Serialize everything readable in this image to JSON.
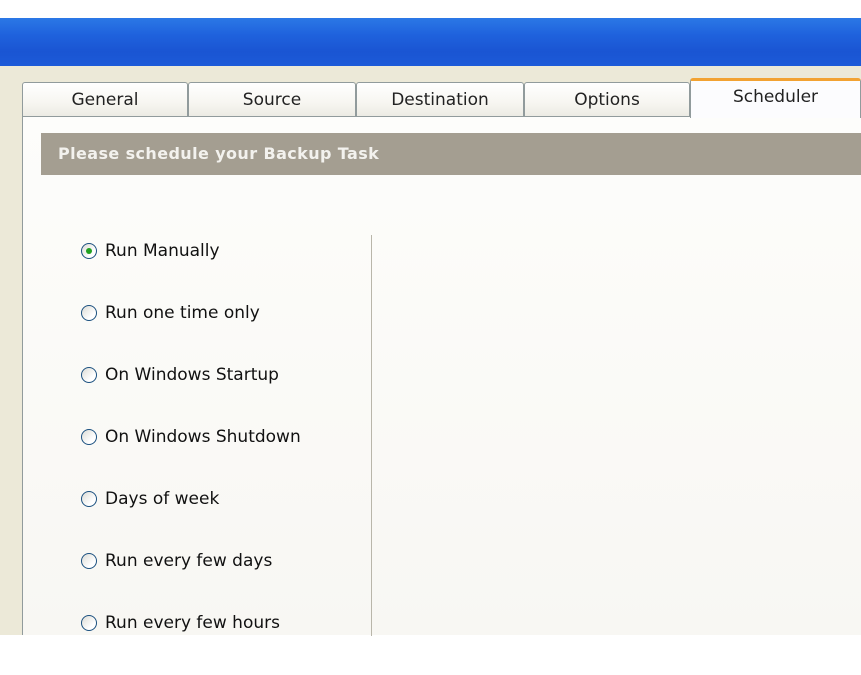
{
  "tabs": [
    {
      "label": "General",
      "active": false
    },
    {
      "label": "Source",
      "active": false
    },
    {
      "label": "Destination",
      "active": false
    },
    {
      "label": "Options",
      "active": false
    },
    {
      "label": "Scheduler",
      "active": true
    }
  ],
  "header": {
    "title": "Please schedule your Backup Task"
  },
  "schedule_options": [
    {
      "label": "Run Manually",
      "checked": true
    },
    {
      "label": "Run one time only",
      "checked": false
    },
    {
      "label": "On Windows Startup",
      "checked": false
    },
    {
      "label": "On Windows Shutdown",
      "checked": false
    },
    {
      "label": "Days of week",
      "checked": false
    },
    {
      "label": "Run every few days",
      "checked": false
    },
    {
      "label": "Run every few hours",
      "checked": false
    }
  ],
  "colors": {
    "titlebar": "#1f62dd",
    "header_bg": "#a49e91",
    "active_tab_accent": "#f2a232",
    "radio_selected": "#21a121"
  }
}
